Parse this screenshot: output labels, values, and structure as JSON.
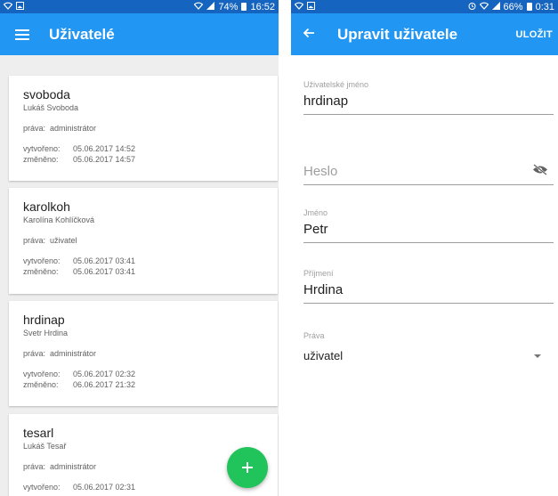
{
  "left": {
    "status": {
      "percent": "74%",
      "time": "16:52"
    },
    "title": "Uživatelé",
    "users": [
      {
        "username": "svoboda",
        "fullname": "Lukáš Svoboda",
        "rights_label": "práva:",
        "rights": "administrátor",
        "created_label": "vytvořeno:",
        "created": "05.06.2017 14:52",
        "changed_label": "změněno:",
        "changed": "05.06.2017 14:57"
      },
      {
        "username": "karolkoh",
        "fullname": "Karolína Kohlíčková",
        "rights_label": "práva:",
        "rights": "uživatel",
        "created_label": "vytvořeno:",
        "created": "05.06.2017 03:41",
        "changed_label": "změněno:",
        "changed": "05.06.2017 03:41"
      },
      {
        "username": "hrdinap",
        "fullname": "Svetr Hrdina",
        "rights_label": "práva:",
        "rights": "administrátor",
        "created_label": "vytvořeno:",
        "created": "05.06.2017 02:32",
        "changed_label": "změněno:",
        "changed": "06.06.2017 21:32"
      },
      {
        "username": "tesarl",
        "fullname": "Lukáš Tesař",
        "rights_label": "práva:",
        "rights": "administrátor",
        "created_label": "vytvořeno:",
        "created": "05.06.2017 02:31"
      }
    ]
  },
  "right": {
    "status": {
      "percent": "66%",
      "time": "0:31"
    },
    "title": "Upravit uživatele",
    "save_label": "ULOŽIT",
    "form": {
      "username_label": "Uživatelské jméno",
      "username_value": "hrdinap",
      "password_placeholder": "Heslo",
      "firstname_label": "Jméno",
      "firstname_value": "Petr",
      "lastname_label": "Příjmení",
      "lastname_value": "Hrdina",
      "rights_label": "Práva",
      "rights_value": "uživatel"
    }
  },
  "colors": {
    "status_bar": "#1565c0",
    "app_bar": "#2196f3",
    "fab": "#21c35b",
    "background": "#eeeeee"
  },
  "icons": {
    "left": [
      "wifi-icon",
      "gallery-icon",
      "signal-icon",
      "battery-icon",
      "menu-icon",
      "plus-icon"
    ],
    "right": [
      "wifi-icon",
      "gallery-icon",
      "alarm-icon",
      "signal-icon",
      "battery-icon",
      "back-arrow-icon",
      "eye-off-icon",
      "dropdown-caret-icon"
    ]
  }
}
